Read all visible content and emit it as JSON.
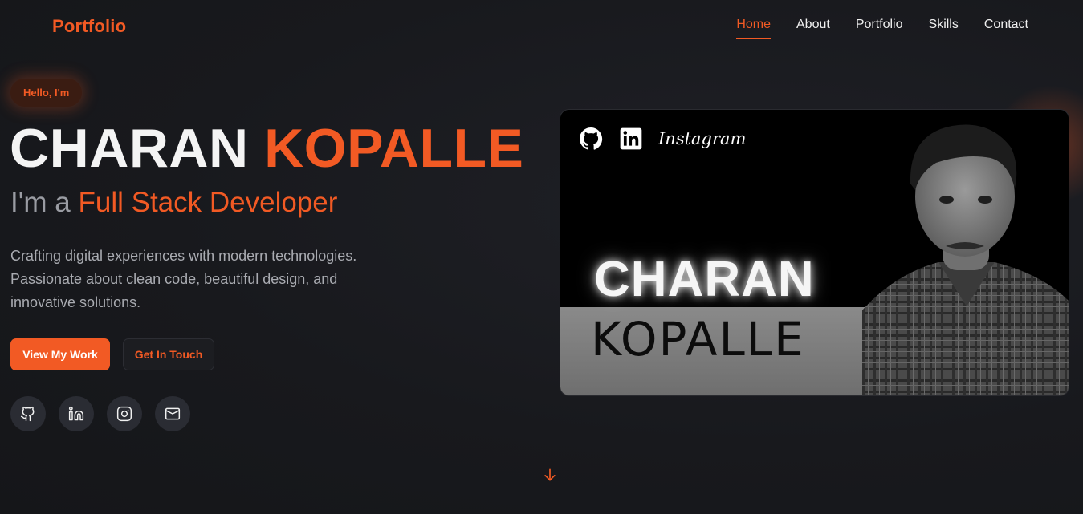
{
  "nav": {
    "logo": "Portfolio",
    "links": [
      "Home",
      "About",
      "Portfolio",
      "Skills",
      "Contact"
    ]
  },
  "hero": {
    "badge": "Hello, I'm",
    "first_name": "CHARAN",
    "last_name": "KOPALLE",
    "role_prefix": "I'm a",
    "role_highlight": "Full Stack Developer",
    "description": "Crafting digital experiences with modern technologies. Passionate about clean code, beautiful design, and innovative solutions.",
    "primary_button": "View My Work",
    "secondary_button": "Get In Touch",
    "socials": [
      "github-icon",
      "linkedin-icon",
      "instagram-icon",
      "mail-icon"
    ]
  },
  "card": {
    "icons": [
      "github-icon",
      "linkedin-icon"
    ],
    "instagram_text": "Instagram",
    "first_name": "CHARAN",
    "last_name": "KOPALLE"
  },
  "colors": {
    "accent": "#f25a24",
    "background": "#18191d",
    "social_bg": "#2a2c33"
  }
}
